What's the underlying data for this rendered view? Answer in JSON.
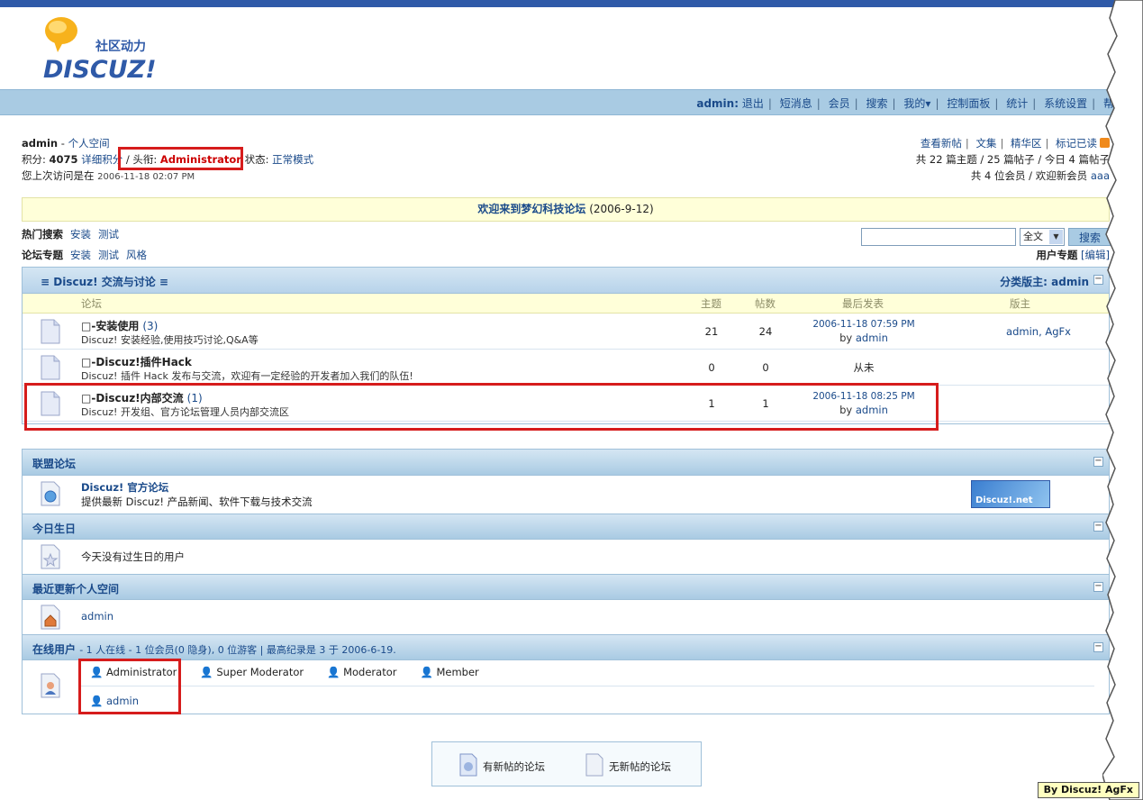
{
  "brand": {
    "slogan": "社区动力",
    "name": "DISCUZ!"
  },
  "nav": {
    "user": "admin:",
    "items": [
      "退出",
      "短消息",
      "会员",
      "搜索",
      "我的",
      "控制面板",
      "统计",
      "系统设置",
      "帮助"
    ]
  },
  "userinfo": {
    "name": "admin",
    "space": "个人空间",
    "points_label": "积分:",
    "points": "4075",
    "detail": "详细积分",
    "title_label": "头衔:",
    "title": "Administrator",
    "status_label": "状态:",
    "status": "正常模式",
    "lastvisit_label": "您上次访问是在",
    "lastvisit": "2006-11-18 02:07 PM"
  },
  "rightinfo": {
    "links": [
      "查看新帖",
      "文集",
      "精华区",
      "标记已读"
    ],
    "stats_line": "共 22 篇主题 / 25 篇帖子 / 今日 4 篇帖子",
    "members_line": "共 4 位会员 / 欢迎新会员",
    "newest": "aaa"
  },
  "announce": {
    "text": "欢迎来到梦幻科技论坛",
    "date": "(2006-9-12)"
  },
  "hot": {
    "label": "热门搜索",
    "items": [
      "安装",
      "测试"
    ]
  },
  "topics": {
    "label": "论坛专题",
    "items": [
      "安装",
      "测试",
      "风格"
    ]
  },
  "search": {
    "value": "",
    "scope": "全文",
    "button": "搜索"
  },
  "userspec": {
    "label": "用户专题",
    "edit": "[编辑]"
  },
  "category": {
    "title": "≡ Discuz! 交流与讨论 ≡",
    "moderator_label": "分类版主:",
    "moderator": "admin",
    "cols": {
      "forum": "论坛",
      "topics": "主题",
      "posts": "帖数",
      "last": "最后发表",
      "mods": "版主"
    },
    "forums": [
      {
        "name": "□-安装使用",
        "count": "(3)",
        "desc": "Discuz! 安装经验,使用技巧讨论,Q&A等",
        "topics": "21",
        "posts": "24",
        "last_time": "2006-11-18 07:59 PM",
        "last_by": "by",
        "last_user": "admin",
        "mods": "admin, AgFx"
      },
      {
        "name": "□-Discuz!插件Hack",
        "count": "",
        "desc": "Discuz! 插件  Hack 发布与交流，欢迎有一定经验的开发者加入我们的队伍!",
        "topics": "0",
        "posts": "0",
        "never": "从未",
        "mods": ""
      },
      {
        "name": "□-Discuz!内部交流",
        "count": "(1)",
        "desc": "Discuz! 开发组、官方论坛管理人员内部交流区",
        "topics": "1",
        "posts": "1",
        "last_time": "2006-11-18 08:25 PM",
        "last_by": "by",
        "last_user": "admin",
        "mods": ""
      }
    ]
  },
  "league": {
    "title": "联盟论坛",
    "name": "Discuz! 官方论坛",
    "desc": "提供最新  Discuz! 产品新闻、软件下载与技术交流",
    "banner": "Discuz!.net"
  },
  "birthday": {
    "title": "今日生日",
    "text": "今天没有过生日的用户"
  },
  "spaces": {
    "title": "最近更新个人空间",
    "user": "admin"
  },
  "online": {
    "title": "在线用户",
    "summary": "- 1 人在线  - 1 位会员(0 隐身), 0 位游客 | 最高纪录是  3 于  2006-6-19.",
    "groups": [
      "Administrator",
      "Super Moderator",
      "Moderator",
      "Member"
    ],
    "users": [
      "admin"
    ]
  },
  "legend": {
    "new": "有新帖的论坛",
    "nonew": "无新帖的论坛"
  },
  "watermark": "By Discuz! AgFx",
  "colors": {
    "accent": "#1a4a8a",
    "highlight": "#d61c1c",
    "nav": "#a9cbe3"
  }
}
